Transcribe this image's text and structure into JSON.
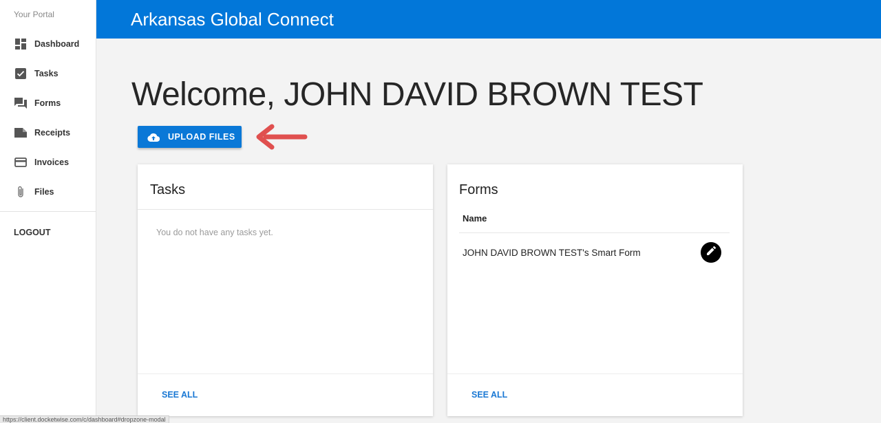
{
  "sidebar": {
    "portal_title": "Your Portal",
    "items": [
      {
        "label": "Dashboard",
        "icon": "dashboard-icon"
      },
      {
        "label": "Tasks",
        "icon": "checkbox-icon"
      },
      {
        "label": "Forms",
        "icon": "forum-icon"
      },
      {
        "label": "Receipts",
        "icon": "receipt-icon"
      },
      {
        "label": "Invoices",
        "icon": "credit-card-icon"
      },
      {
        "label": "Files",
        "icon": "paperclip-icon"
      }
    ],
    "logout_label": "LOGOUT"
  },
  "header": {
    "app_title": "Arkansas Global Connect",
    "bar_color": "#0277d9"
  },
  "main": {
    "welcome": "Welcome, JOHN DAVID BROWN TEST",
    "upload_label": "UPLOAD FILES",
    "upload_icon": "cloud-upload-icon",
    "annotation_arrow_color": "#e0504f"
  },
  "tasks_card": {
    "title": "Tasks",
    "empty_text": "You do not have any tasks yet.",
    "see_all": "SEE ALL"
  },
  "forms_card": {
    "title": "Forms",
    "column_header": "Name",
    "rows": [
      {
        "name": "JOHN DAVID BROWN TEST's Smart Form",
        "action_icon": "pencil-icon"
      }
    ],
    "see_all": "SEE ALL"
  },
  "status_bar": {
    "url": "https://client.docketwise.com/c/dashboard#dropzone-modal"
  }
}
